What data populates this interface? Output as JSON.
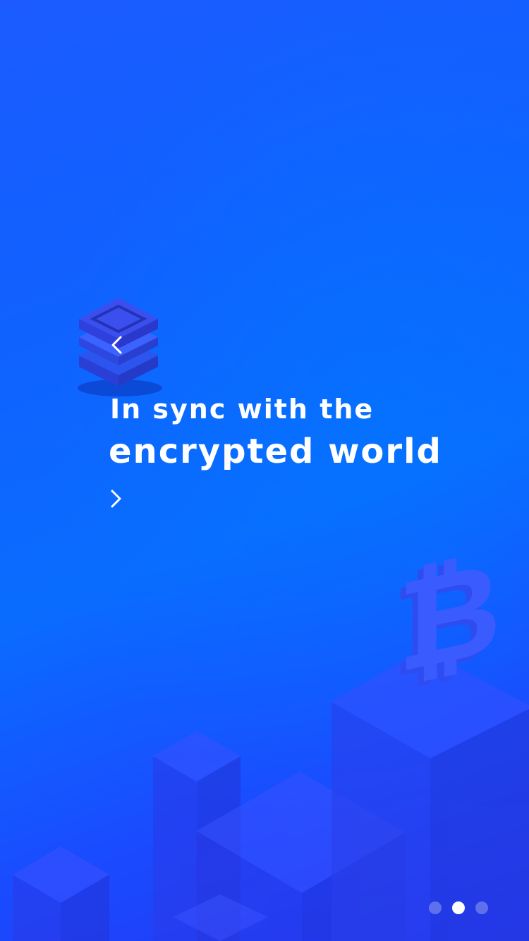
{
  "onboarding": {
    "headline_line1": "In sync with the",
    "headline_line2": "encrypted world",
    "icons": {
      "stack": "layered-cube-icon",
      "prev": "chevron-left-icon",
      "next": "chevron-right-icon",
      "bitcoin": "bitcoin-icon"
    }
  },
  "pagination": {
    "total": 3,
    "active_index": 1
  },
  "colors": {
    "background_top": "#1b5bff",
    "background_mid": "#0a6cff",
    "background_bottom": "#2336f3",
    "text": "#ffffff",
    "dot_inactive": "rgba(255,255,255,0.28)",
    "dot_active": "#ffffff"
  }
}
